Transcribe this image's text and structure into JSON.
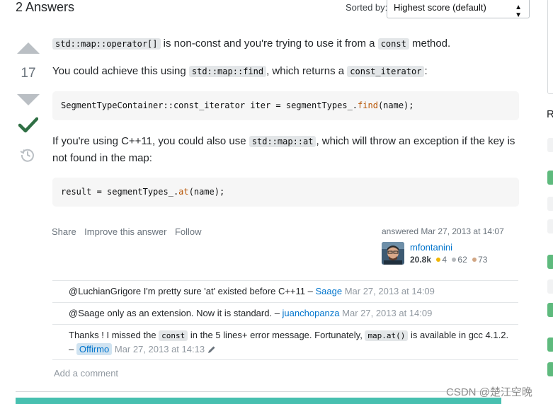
{
  "header": {
    "answers_title": "2 Answers",
    "sorted_by_label": "Sorted by:",
    "sort_value": "Highest score (default)"
  },
  "votes": {
    "count": "17"
  },
  "answer": {
    "p1_code": "std::map::operator[]",
    "p1_mid": " is non-const and you're trying to use it from a ",
    "p1_code2": "const",
    "p1_end": " method.",
    "p2_start": "You could achieve this using ",
    "p2_code": "std::map::find",
    "p2_mid": ", which returns a ",
    "p2_code2": "const_iterator",
    "p2_end": ":",
    "code1_pre": "SegmentTypeContainer::const_iterator iter = segmentTypes_.",
    "code1_fn": "find",
    "code1_post": "(name);",
    "p3_start": "If you're using C++11, you could also use ",
    "p3_code": "std::map::at",
    "p3_end": ", which will throw an exception if the key is",
    "p3_line2": "not found in the map:",
    "code2_pre": "result = segmentTypes_.",
    "code2_fn": "at",
    "code2_post": "(name);"
  },
  "post_menu": {
    "share": "Share",
    "improve": "Improve this answer",
    "follow": "Follow"
  },
  "user_card": {
    "answered": "answered Mar 27, 2013 at 14:07",
    "name": "mfontanini",
    "reputation": "20.8k",
    "gold": "4",
    "silver": "62",
    "bronze": "73"
  },
  "comments": [
    {
      "text": "@LuchianGrigore I'm pretty sure 'at' existed before C++11 – ",
      "user": "Saage",
      "date": "Mar 27, 2013 at 14:09"
    },
    {
      "text": "@Saage only as an extension. Now it is standard. – ",
      "user": "juanchopanza",
      "date": "Mar 27, 2013 at 14:09"
    },
    {
      "t1": "Thanks ! I missed the ",
      "code1": "const",
      "t2": " in the 5 lines+ error message. Fortunately, ",
      "code2": "map.at()",
      "t3": " is available in gcc 4.1.2.",
      "dash": "– ",
      "user": "Offirmo",
      "date": "Mar 27, 2013 at 14:13"
    }
  ],
  "add_comment": "Add a comment",
  "sidebar": {
    "letter": "R"
  },
  "watermark": "CSDN @楚江空晚",
  "colors": {
    "accent_link": "#0074cc",
    "accepted_green": "#2f6f44",
    "bottom_bar": "#48c0b0",
    "gold": "#f1b600",
    "silver": "#b4b8bc",
    "bronze": "#d1a684"
  },
  "icons": [
    "caret-updown-icon",
    "upvote-icon",
    "downvote-icon",
    "accepted-check-icon",
    "history-icon",
    "edit-pencil-icon"
  ]
}
